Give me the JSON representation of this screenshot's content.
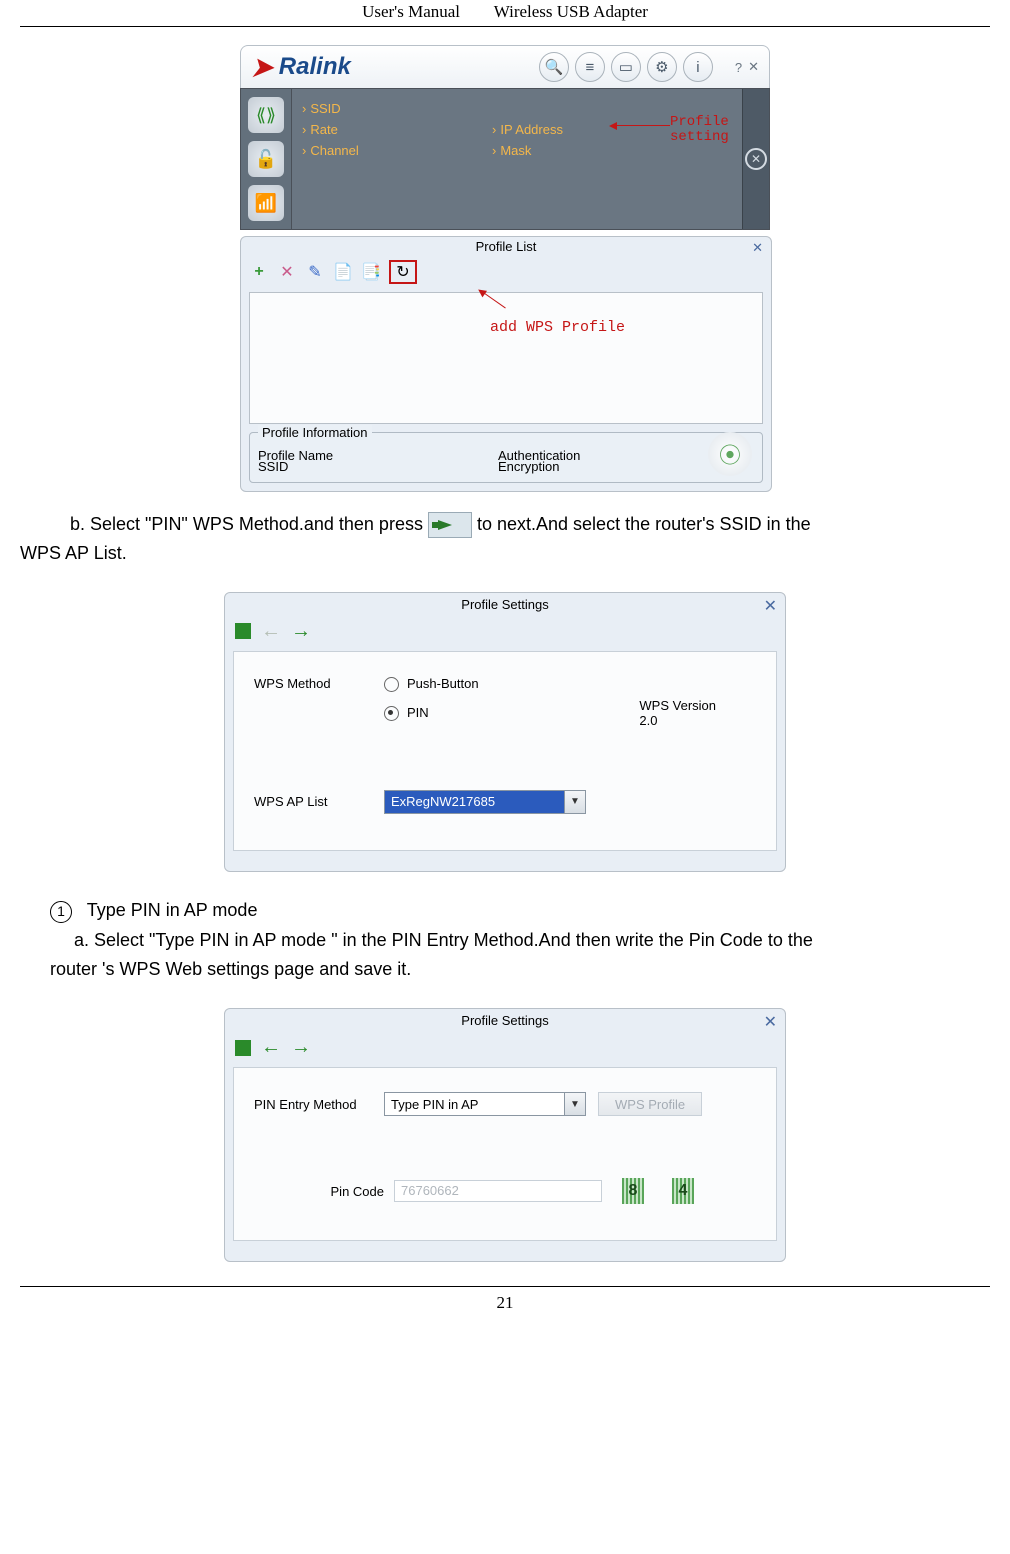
{
  "header": {
    "left": "User's Manual",
    "right": "Wireless USB Adapter"
  },
  "footer": {
    "page": "21"
  },
  "app": {
    "brand": "Ralink",
    "annot_profile": "Profile\nsetting",
    "fields": {
      "ssid": "SSID",
      "rate": "Rate",
      "channel": "Channel",
      "ip": "IP Address",
      "mask": "Mask"
    }
  },
  "profile_list": {
    "title": "Profile List",
    "annot_add": "add WPS Profile",
    "info_legend": "Profile Information",
    "pname": "Profile Name",
    "ssid": "SSID",
    "auth": "Authentication",
    "enc": "Encryption"
  },
  "step_b": {
    "prefix": "b.    Select \"PIN\" WPS Method.and then press",
    "suffix": "to next.And select the router's SSID in the",
    "wrap": "WPS AP List."
  },
  "settings1": {
    "title": "Profile Settings",
    "wps_method": "WPS Method",
    "opt_push": "Push-Button",
    "opt_pin": "PIN",
    "wps_version_label": "WPS Version",
    "wps_version_value": "2.0",
    "ap_list_label": "WPS AP List",
    "ap_list_value": "ExRegNW217685"
  },
  "step_sub": {
    "num": "1",
    "text": "Type PIN in AP mode"
  },
  "step_a": {
    "prefix": "a.    Select \"Type PIN in AP mode \" in the PIN Entry Method.And then write the Pin Code to the",
    "wrap": "router 's WPS Web settings page and save it."
  },
  "settings2": {
    "title": "Profile Settings",
    "entry_label": "PIN Entry Method",
    "entry_value": "Type PIN in AP",
    "wps_profile_btn": "WPS Profile",
    "pin_label": "Pin Code",
    "pin_value": "76760662",
    "digit1": "8",
    "digit2": "4"
  }
}
